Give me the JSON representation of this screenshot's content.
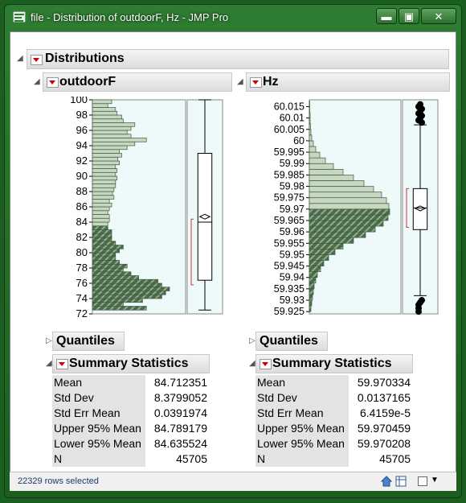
{
  "window": {
    "title": "file - Distribution of outdoorF, Hz - JMP Pro",
    "minimize_glyph": "▬",
    "maximize_glyph": "▣",
    "close_glyph": "✕"
  },
  "report": {
    "title": "Distributions"
  },
  "panels": [
    {
      "variable": "outdoorF",
      "quantiles_label": "Quantiles",
      "summary_label": "Summary Statistics",
      "stats": [
        {
          "label": "Mean",
          "value": "84.712351"
        },
        {
          "label": "Std Dev",
          "value": "8.3799052"
        },
        {
          "label": "Std Err Mean",
          "value": "0.0391974"
        },
        {
          "label": "Upper 95% Mean",
          "value": "84.789179"
        },
        {
          "label": "Lower 95% Mean",
          "value": "84.635524"
        },
        {
          "label": "N",
          "value": "45705"
        }
      ]
    },
    {
      "variable": "Hz",
      "quantiles_label": "Quantiles",
      "summary_label": "Summary Statistics",
      "stats": [
        {
          "label": "Mean",
          "value": "59.970334"
        },
        {
          "label": "Std Dev",
          "value": "0.0137165"
        },
        {
          "label": "Std Err Mean",
          "value": "6.4159e-5"
        },
        {
          "label": "Upper 95% Mean",
          "value": "59.970459"
        },
        {
          "label": "Lower 95% Mean",
          "value": "59.970208"
        },
        {
          "label": "N",
          "value": "45705"
        }
      ]
    }
  ],
  "chart_data": [
    {
      "type": "bar",
      "orientation": "horizontal",
      "variable": "outdoorF",
      "ylim": [
        72,
        100
      ],
      "y_ticks": [
        "100",
        "98",
        "96",
        "94",
        "92",
        "90",
        "88",
        "86",
        "84",
        "82",
        "80",
        "78",
        "76",
        "74",
        "72"
      ],
      "bin_width": 0.5,
      "bin_starts": [
        72.5,
        73,
        73.5,
        74,
        74.5,
        75,
        75.5,
        76,
        76.5,
        77,
        77.5,
        78,
        78.5,
        79,
        79.5,
        80,
        80.5,
        81,
        81.5,
        82,
        82.5,
        83,
        83.5,
        84,
        84.5,
        85,
        85.5,
        86,
        86.5,
        87,
        87.5,
        88,
        88.5,
        89,
        89.5,
        90,
        90.5,
        91,
        91.5,
        92,
        92.5,
        93,
        93.5,
        94,
        94.5,
        95,
        95.5,
        96,
        96.5,
        97,
        97.5,
        98,
        98.5,
        99,
        99.5
      ],
      "relative_heights": [
        0.7,
        0.4,
        0.65,
        0.9,
        0.95,
        1.0,
        0.9,
        0.85,
        0.6,
        0.5,
        0.4,
        0.45,
        0.35,
        0.3,
        0.3,
        0.35,
        0.4,
        0.3,
        0.25,
        0.25,
        0.25,
        0.2,
        0.2,
        0.22,
        0.22,
        0.2,
        0.22,
        0.25,
        0.22,
        0.28,
        0.26,
        0.28,
        0.3,
        0.3,
        0.32,
        0.3,
        0.32,
        0.3,
        0.35,
        0.33,
        0.38,
        0.35,
        0.45,
        0.55,
        0.7,
        0.5,
        0.45,
        0.5,
        0.55,
        0.4,
        0.38,
        0.32,
        0.3,
        0.2,
        0.25
      ],
      "shaded_below": 83.5,
      "box": {
        "min": 72.5,
        "q1": 76.4,
        "median": 84.0,
        "mean": 84.71,
        "q3": 93.0,
        "max": 100
      },
      "shortest_half": [
        75.8,
        84.4
      ]
    },
    {
      "type": "bar",
      "orientation": "horizontal",
      "variable": "Hz",
      "ylim": [
        59.924,
        60.018
      ],
      "y_ticks": [
        "60.015",
        "60.01",
        "60.005",
        "60",
        "59.995",
        "59.99",
        "59.985",
        "59.98",
        "59.975",
        "59.97",
        "59.965",
        "59.96",
        "59.955",
        "59.95",
        "59.945",
        "59.94",
        "59.935",
        "59.93",
        "59.925"
      ],
      "bin_width": 0.0025,
      "bin_starts": [
        59.925,
        59.9275,
        59.93,
        59.9325,
        59.935,
        59.9375,
        59.94,
        59.9425,
        59.945,
        59.9475,
        59.95,
        59.9525,
        59.955,
        59.9575,
        59.96,
        59.9625,
        59.965,
        59.9675,
        59.97,
        59.9725,
        59.975,
        59.9775,
        59.98,
        59.9825,
        59.985,
        59.9875,
        59.99,
        59.9925,
        59.995,
        59.9975,
        60,
        60.0025,
        60.005,
        60.0075,
        60.01,
        60.0125,
        60.015
      ],
      "relative_heights": [
        0.02,
        0.03,
        0.04,
        0.05,
        0.06,
        0.08,
        0.1,
        0.14,
        0.18,
        0.24,
        0.32,
        0.42,
        0.55,
        0.7,
        0.82,
        0.92,
        0.98,
        1.0,
        0.99,
        0.96,
        0.9,
        0.8,
        0.68,
        0.55,
        0.42,
        0.3,
        0.2,
        0.13,
        0.08,
        0.05,
        0.03,
        0.02,
        0.015,
        0.01,
        0.01,
        0.005,
        0.005
      ],
      "shaded_below": 59.97,
      "box": {
        "min": 59.932,
        "q1": 59.961,
        "median": 59.9705,
        "mean": 59.970334,
        "q3": 59.979,
        "max": 60.007
      },
      "outliers_low": [
        59.925,
        59.9265,
        59.928,
        59.929,
        59.93
      ],
      "outliers_high": [
        60.008,
        60.009,
        60.01,
        60.011,
        60.012,
        60.013,
        60.014,
        60.015,
        60.016
      ],
      "shortest_half": [
        59.962,
        59.979
      ]
    }
  ],
  "statusbar": {
    "text": "22329 rows selected",
    "home_icon": "home-icon",
    "table_icon": "data-table-icon"
  },
  "colors": {
    "bar_fill": "#c6d8c2",
    "bar_stroke": "#3f5a3f",
    "shaded_fill": "#4e6b4e",
    "plot_bg": "#eefafa",
    "quantile_bracket": "#c8323c"
  }
}
